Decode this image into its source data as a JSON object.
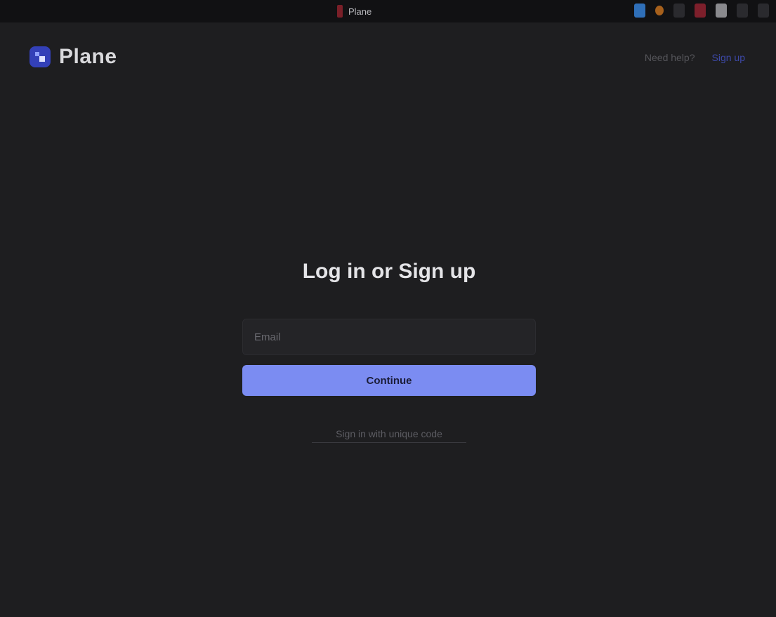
{
  "browser": {
    "tab_title": "Plane"
  },
  "header": {
    "brand_name": "Plane",
    "nav_link": "Need help?",
    "nav_cta": "Sign up"
  },
  "auth": {
    "title": "Log in or Sign up",
    "email_placeholder": "Email",
    "continue_label": "Continue",
    "alt_link": "Sign in with unique code"
  },
  "colors": {
    "background": "#1e1e20",
    "accent": "#7b8cf2",
    "brand": "#3340b8"
  }
}
